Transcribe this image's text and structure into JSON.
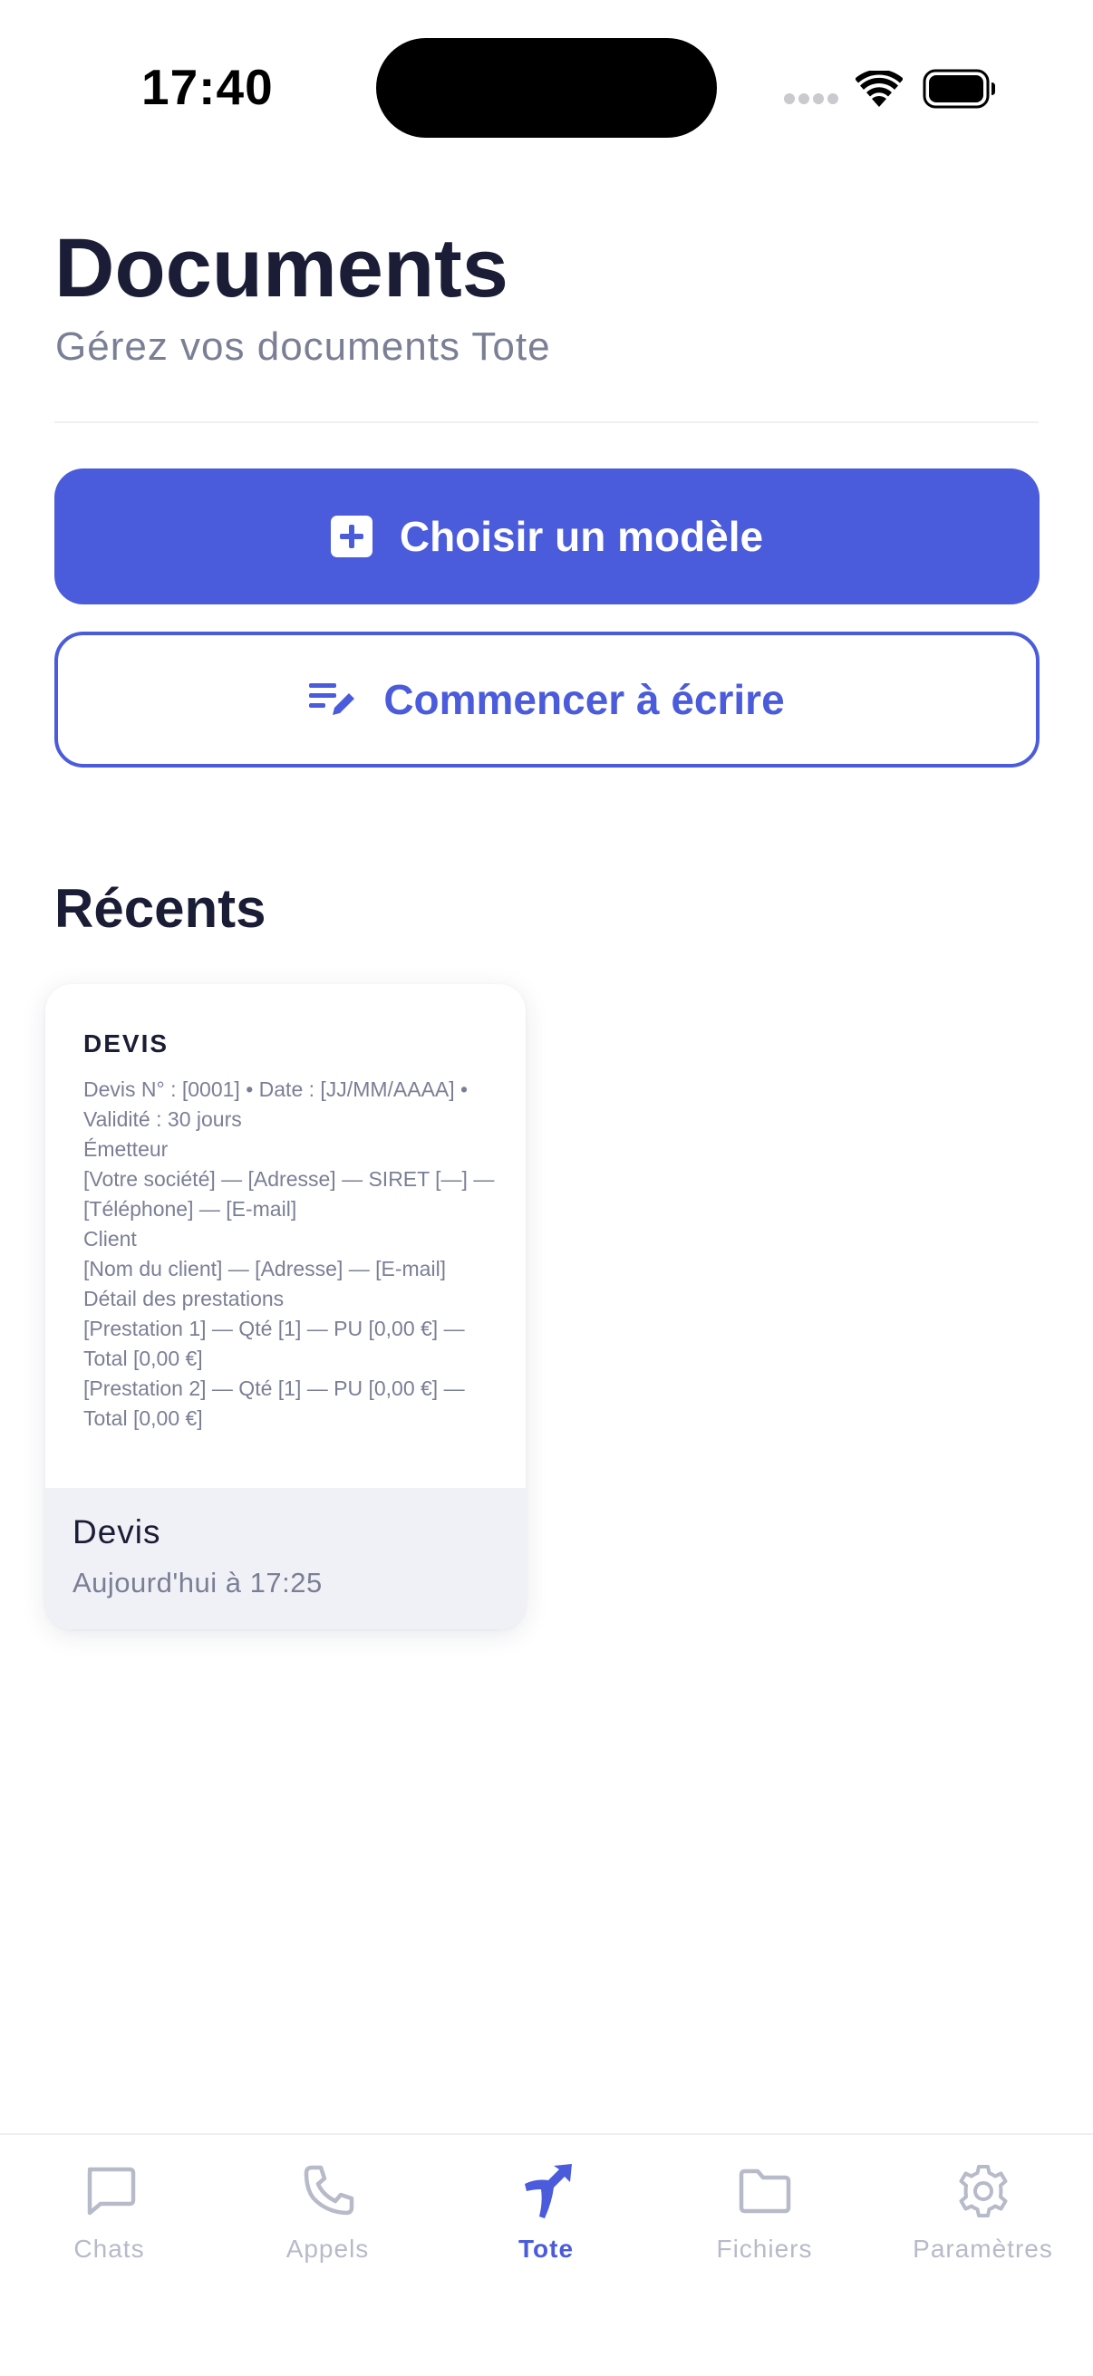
{
  "status_bar": {
    "time": "17:40"
  },
  "header": {
    "title": "Documents",
    "subtitle": "Gérez vos documents Tote"
  },
  "actions": {
    "choose_template_label": "Choisir un modèle",
    "start_writing_label": "Commencer à écrire"
  },
  "recents": {
    "section_title": "Récents",
    "items": [
      {
        "preview_title": "DEVIS",
        "preview_lines": [
          "Devis N° : [0001]  •  Date : [JJ/MM/AAAA]  •  Validité : 30 jours",
          "Émetteur",
          "[Votre société] — [Adresse] — SIRET [—] — [Téléphone] — [E-mail]",
          "Client",
          "[Nom du client] — [Adresse] — [E-mail]",
          "Détail des prestations",
          "[Prestation 1] — Qté [1] — PU [0,00 €] — Total [0,00 €]",
          "[Prestation 2] — Qté [1] — PU [0,00 €] — Total [0,00 €]"
        ],
        "name": "Devis",
        "date": "Aujourd'hui à 17:25"
      }
    ]
  },
  "tabbar": {
    "tabs": [
      {
        "label": "Chats",
        "icon": "chat-icon"
      },
      {
        "label": "Appels",
        "icon": "phone-icon"
      },
      {
        "label": "Tote",
        "icon": "tote-logo-icon",
        "active": true
      },
      {
        "label": "Fichiers",
        "icon": "folder-icon"
      },
      {
        "label": "Paramètres",
        "icon": "gear-icon"
      }
    ]
  },
  "colors": {
    "accent": "#4a5bdc",
    "text_primary": "#1b1d36",
    "text_secondary": "#7a7f95",
    "tab_inactive": "#b7bac8",
    "card_footer": "#f0f1f6"
  }
}
